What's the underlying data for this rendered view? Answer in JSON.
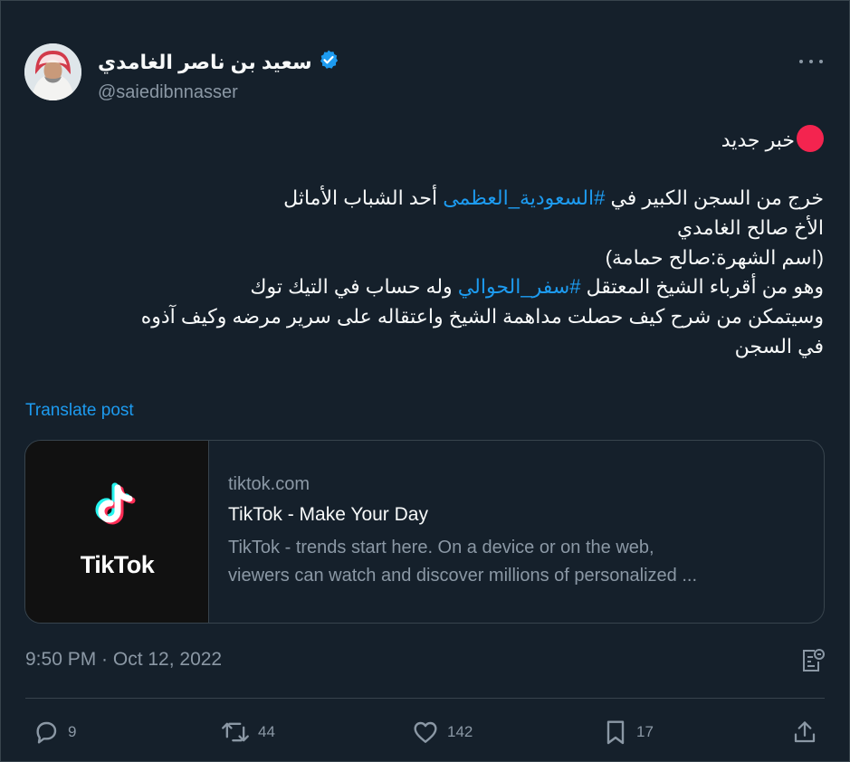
{
  "author": {
    "display_name": "سعيد بن ناصر الغامدي",
    "handle": "@saiedibnnasser",
    "verified": true
  },
  "post": {
    "lines": [
      {
        "segments": [
          {
            "text": "خبر جديد",
            "type": "text"
          }
        ],
        "prefix_icon": "red-circle-icon"
      },
      {
        "segments": [
          {
            "text": "خرج من السجن الكبير في ",
            "type": "text"
          },
          {
            "text": "#السعودية_العظمى",
            "type": "hashtag"
          },
          {
            "text": " أحد الشباب الأماثل",
            "type": "text"
          }
        ]
      },
      {
        "segments": [
          {
            "text": "الأخ صالح الغامدي",
            "type": "text"
          }
        ]
      },
      {
        "segments": [
          {
            "text": "(اسم الشهرة:صالح حمامة)",
            "type": "text"
          }
        ]
      },
      {
        "segments": [
          {
            "text": "وهو من أقرباء الشيخ المعتقل ",
            "type": "text"
          },
          {
            "text": "#سفر_الحوالي",
            "type": "hashtag"
          },
          {
            "text": " وله حساب في التيك توك",
            "type": "text"
          }
        ]
      },
      {
        "segments": [
          {
            "text": "وسيتمكن من شرح كيف حصلت مداهمة الشيخ واعتقاله على سرير مرضه وكيف آذوه",
            "type": "text"
          }
        ]
      },
      {
        "segments": [
          {
            "text": "في السجن",
            "type": "text"
          }
        ]
      }
    ],
    "translate_label": "Translate post"
  },
  "card": {
    "thumb_text": "TikTok",
    "domain": "tiktok.com",
    "title": "TikTok - Make Your Day",
    "description_line1": "TikTok - trends start here. On a device or on the web,",
    "description_line2": "viewers can watch and discover millions of personalized ..."
  },
  "timestamp": "9:50 PM · Oct 12, 2022",
  "actions": {
    "replies": "9",
    "reposts": "44",
    "likes": "142",
    "bookmarks": "17"
  },
  "colors": {
    "background": "#15202b",
    "accent": "#1d9bf0",
    "muted": "#8b98a5",
    "border": "#38444d",
    "red_dot": "#f4244f"
  }
}
